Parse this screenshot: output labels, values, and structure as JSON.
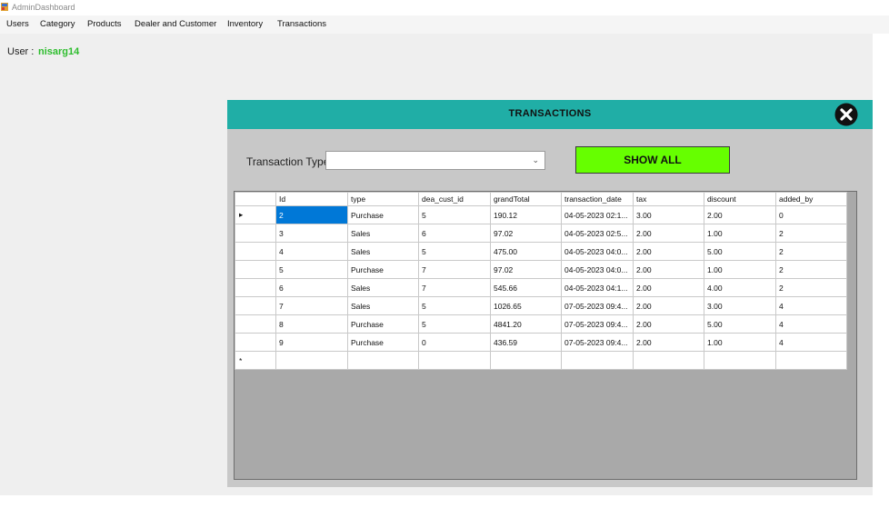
{
  "window": {
    "title": "AdminDashboard"
  },
  "menu": [
    "Users",
    "Category",
    "Products",
    "Dealer and Customer",
    "Inventory",
    "Transactions"
  ],
  "user": {
    "label": "User :",
    "name": "nisarg14"
  },
  "panel": {
    "title": "TRANSACTIONS"
  },
  "filter": {
    "label": "Transaction Type",
    "value": "",
    "button": "SHOW ALL"
  },
  "grid": {
    "columns": [
      "Id",
      "type",
      "dea_cust_id",
      "grandTotal",
      "transaction_date",
      "tax",
      "discount",
      "added_by"
    ],
    "rows": [
      [
        "2",
        "Purchase",
        "5",
        "190.12",
        "04-05-2023 02:1...",
        "3.00",
        "2.00",
        "0"
      ],
      [
        "3",
        "Sales",
        "6",
        "97.02",
        "04-05-2023 02:5...",
        "2.00",
        "1.00",
        "2"
      ],
      [
        "4",
        "Sales",
        "5",
        "475.00",
        "04-05-2023 04:0...",
        "2.00",
        "5.00",
        "2"
      ],
      [
        "5",
        "Purchase",
        "7",
        "97.02",
        "04-05-2023 04:0...",
        "2.00",
        "1.00",
        "2"
      ],
      [
        "6",
        "Sales",
        "7",
        "545.66",
        "04-05-2023 04:1...",
        "2.00",
        "4.00",
        "2"
      ],
      [
        "7",
        "Sales",
        "5",
        "1026.65",
        "07-05-2023 09:4...",
        "2.00",
        "3.00",
        "4"
      ],
      [
        "8",
        "Purchase",
        "5",
        "4841.20",
        "07-05-2023 09:4...",
        "2.00",
        "5.00",
        "4"
      ],
      [
        "9",
        "Purchase",
        "0",
        "436.59",
        "07-05-2023 09:4...",
        "2.00",
        "1.00",
        "4"
      ]
    ],
    "selected_row_marker": "▸",
    "new_row_marker": "*"
  },
  "colors": {
    "header": "#20aea6",
    "button": "#66ff00",
    "user_name": "#2dbd2d",
    "selection": "#0078d7"
  }
}
